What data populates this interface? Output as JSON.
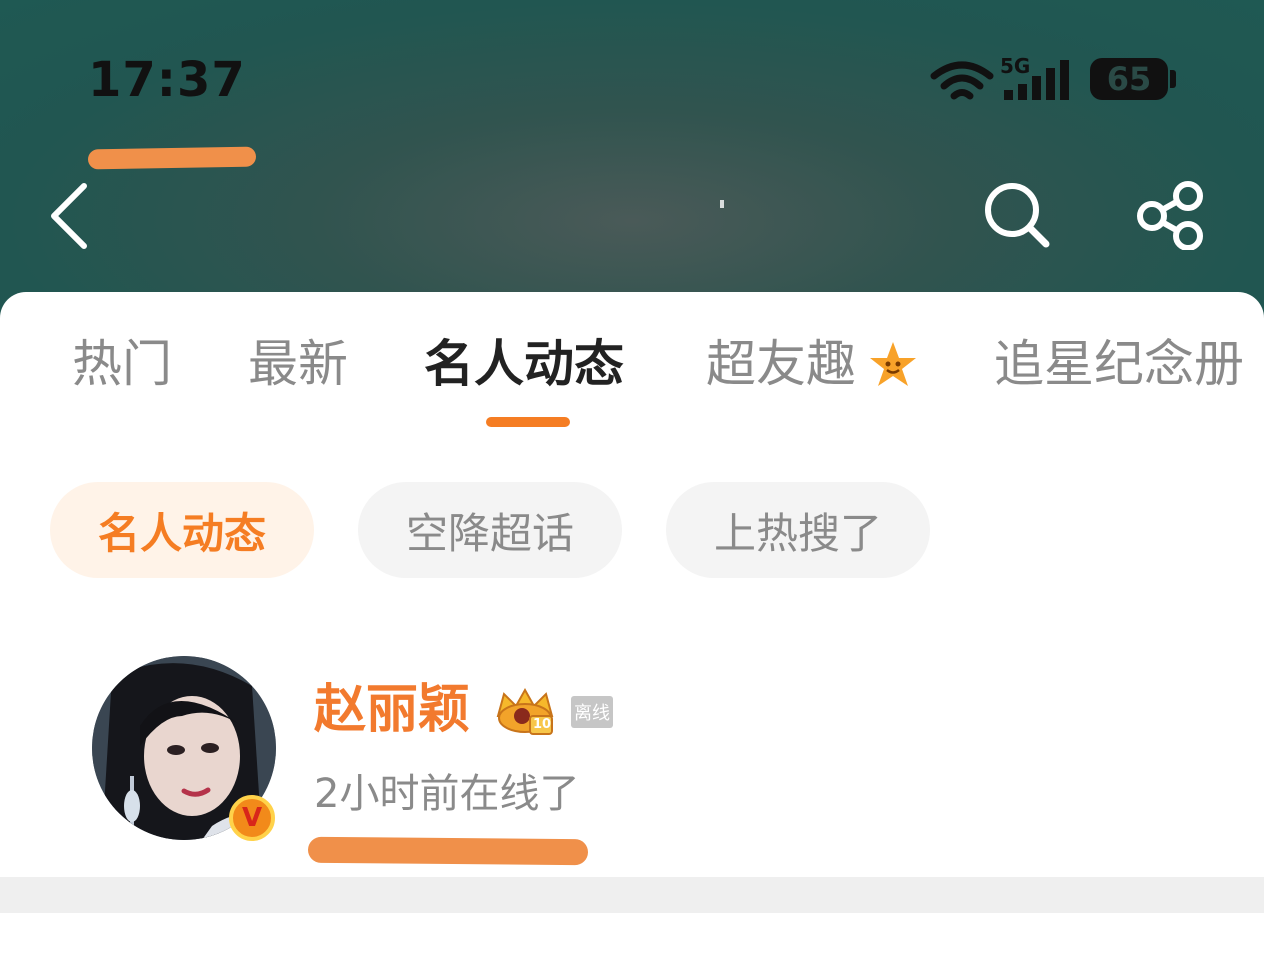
{
  "status_bar": {
    "time": "17:37",
    "network": "5G",
    "battery": "65"
  },
  "header": {
    "back_icon": "chevron-left-icon",
    "search_icon": "search-icon",
    "share_icon": "share-icon"
  },
  "tabs": [
    {
      "label": "热门",
      "active": false
    },
    {
      "label": "最新",
      "active": false
    },
    {
      "label": "名人动态",
      "active": true
    },
    {
      "label": "超友趣",
      "active": false,
      "badge_icon": "star-face-icon"
    },
    {
      "label": "追星纪念册",
      "active": false
    }
  ],
  "filter_chips": [
    {
      "label": "名人动态",
      "active": true
    },
    {
      "label": "空降超话",
      "active": false
    },
    {
      "label": "上热搜了",
      "active": false
    }
  ],
  "user_card": {
    "name": "赵丽颖",
    "verified_badge": "V",
    "crown_level": "10",
    "status_badge": "离线",
    "last_online": "2小时前在线了"
  },
  "colors": {
    "accent": "#f57d23",
    "name_color": "#f27a2e",
    "header_bg": "#215651",
    "chip_active_bg": "#fff3e8",
    "chip_bg": "#f4f4f4"
  }
}
